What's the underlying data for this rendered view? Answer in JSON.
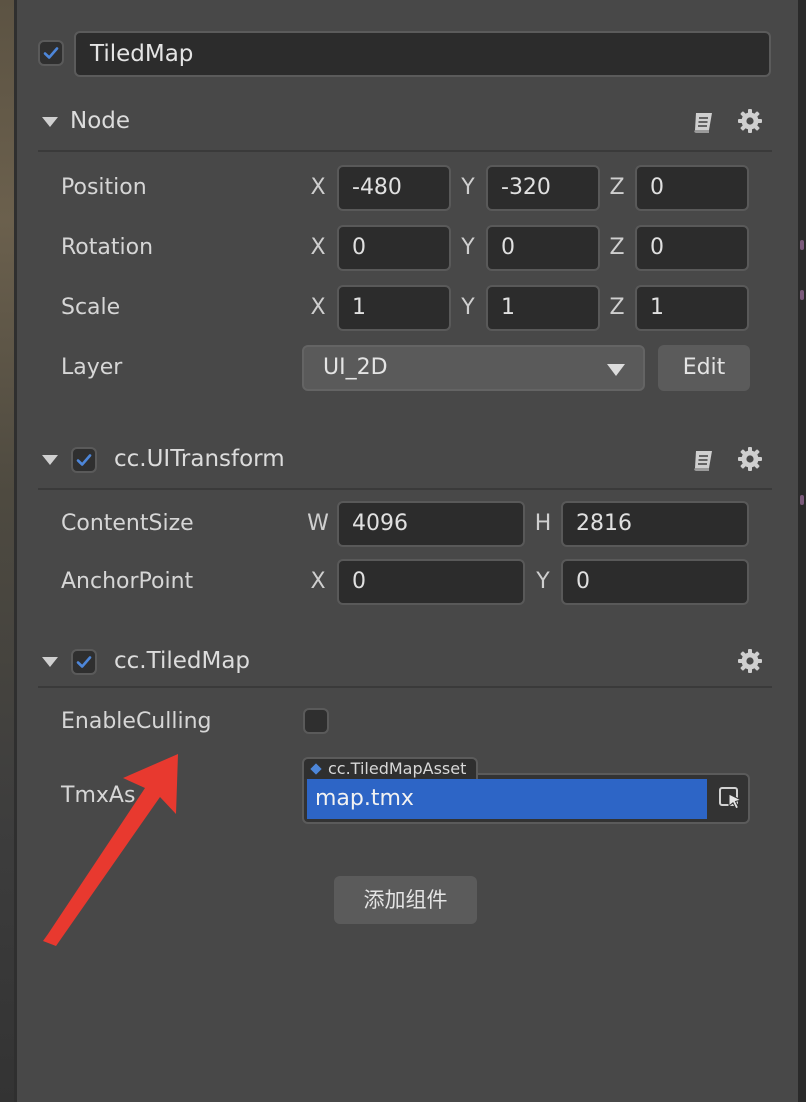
{
  "node_name": {
    "value": "TiledMap",
    "enabled": true
  },
  "node_section": {
    "title": "Node",
    "rows": {
      "position": {
        "label": "Position",
        "x": "-480",
        "y": "-320",
        "z": "0"
      },
      "rotation": {
        "label": "Rotation",
        "x": "0",
        "y": "0",
        "z": "0"
      },
      "scale": {
        "label": "Scale",
        "x": "1",
        "y": "1",
        "z": "1"
      },
      "layer": {
        "label": "Layer",
        "value": "UI_2D",
        "edit_label": "Edit"
      }
    },
    "axis": {
      "x": "X",
      "y": "Y",
      "z": "Z"
    }
  },
  "ui_transform": {
    "title": "cc.UITransform",
    "enabled": true,
    "content_size": {
      "label": "ContentSize",
      "w_axis": "W",
      "h_axis": "H",
      "w": "4096",
      "h": "2816"
    },
    "anchor_point": {
      "label": "AnchorPoint",
      "x_axis": "X",
      "y_axis": "Y",
      "x": "0",
      "y": "0"
    }
  },
  "tiled_map": {
    "title": "cc.TiledMap",
    "enabled": true,
    "enable_culling": {
      "label": "EnableCulling",
      "checked": false
    },
    "tmx_asset": {
      "label": "TmxAs",
      "type_tag": "cc.TiledMapAsset",
      "value": "map.tmx"
    }
  },
  "add_component_label": "添加组件",
  "colors": {
    "accent": "#2d65c6",
    "check": "#4d86d9",
    "annotation_arrow": "#e8392f",
    "panel": "#484848"
  },
  "icons": [
    "checkmark-icon",
    "chevron-down-icon",
    "help-book-icon",
    "gear-icon",
    "dropdown-caret-icon",
    "asset-picker-icon",
    "annotation-arrow"
  ]
}
